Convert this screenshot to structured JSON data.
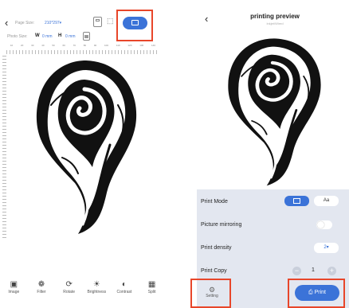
{
  "left": {
    "back_glyph": "‹",
    "page_size_label": "Page Size:",
    "page_size_value": "210*297",
    "page_size_caret": "▾",
    "photo_size_label": "Photo Size:",
    "w_label": "W",
    "w_value": "0 mm",
    "h_label": "H",
    "h_value": "0 mm",
    "ruler_top_ticks": [
      "10",
      "20",
      "30",
      "40",
      "50",
      "60",
      "70",
      "80",
      "90",
      "100",
      "110",
      "120",
      "130",
      "140"
    ],
    "toolbar": [
      {
        "label": "Image",
        "icon": "image-icon",
        "glyph": "▣"
      },
      {
        "label": "Filter",
        "icon": "filter-icon",
        "glyph": "❁"
      },
      {
        "label": "Rotate",
        "icon": "rotate-icon",
        "glyph": "⟳"
      },
      {
        "label": "Brightness",
        "icon": "brightness-icon",
        "glyph": "☀"
      },
      {
        "label": "Contrast",
        "icon": "contrast-icon",
        "glyph": "◐"
      },
      {
        "label": "Split",
        "icon": "split-icon",
        "glyph": "▦"
      }
    ]
  },
  "right": {
    "back_glyph": "‹",
    "title": "printing preview",
    "subtitle": "Inkjet/Wired",
    "rows": {
      "print_mode": "Print Mode",
      "print_mode_alt": "Aa",
      "mirroring": "Picture mirroring",
      "density": "Print density",
      "density_value": "2",
      "density_caret": "▾",
      "copy": "Print Copy",
      "copy_minus": "−",
      "copy_value": "1",
      "copy_plus": "+"
    },
    "setting_label": "Setting",
    "print_label": "Print"
  },
  "colors": {
    "accent": "#3b73d8",
    "highlight": "#e8462a",
    "panel": "#e3e7f0"
  }
}
